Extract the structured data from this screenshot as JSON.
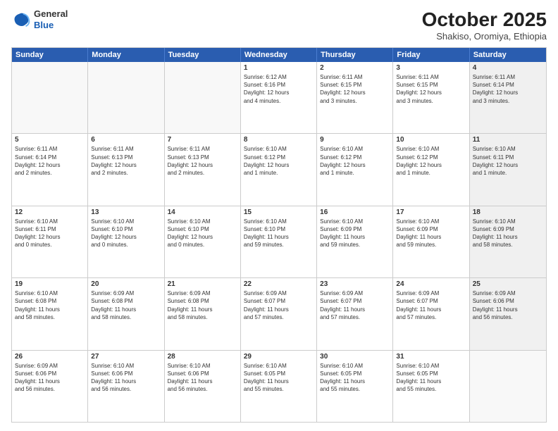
{
  "header": {
    "logo_line1": "General",
    "logo_line2": "Blue",
    "month": "October 2025",
    "location": "Shakiso, Oromiya, Ethiopia"
  },
  "weekdays": [
    "Sunday",
    "Monday",
    "Tuesday",
    "Wednesday",
    "Thursday",
    "Friday",
    "Saturday"
  ],
  "rows": [
    [
      {
        "day": "",
        "text": "",
        "empty": true
      },
      {
        "day": "",
        "text": "",
        "empty": true
      },
      {
        "day": "",
        "text": "",
        "empty": true
      },
      {
        "day": "1",
        "text": "Sunrise: 6:12 AM\nSunset: 6:16 PM\nDaylight: 12 hours\nand 4 minutes.",
        "empty": false
      },
      {
        "day": "2",
        "text": "Sunrise: 6:11 AM\nSunset: 6:15 PM\nDaylight: 12 hours\nand 3 minutes.",
        "empty": false
      },
      {
        "day": "3",
        "text": "Sunrise: 6:11 AM\nSunset: 6:15 PM\nDaylight: 12 hours\nand 3 minutes.",
        "empty": false
      },
      {
        "day": "4",
        "text": "Sunrise: 6:11 AM\nSunset: 6:14 PM\nDaylight: 12 hours\nand 3 minutes.",
        "empty": false,
        "shaded": true
      }
    ],
    [
      {
        "day": "5",
        "text": "Sunrise: 6:11 AM\nSunset: 6:14 PM\nDaylight: 12 hours\nand 2 minutes.",
        "empty": false
      },
      {
        "day": "6",
        "text": "Sunrise: 6:11 AM\nSunset: 6:13 PM\nDaylight: 12 hours\nand 2 minutes.",
        "empty": false
      },
      {
        "day": "7",
        "text": "Sunrise: 6:11 AM\nSunset: 6:13 PM\nDaylight: 12 hours\nand 2 minutes.",
        "empty": false
      },
      {
        "day": "8",
        "text": "Sunrise: 6:10 AM\nSunset: 6:12 PM\nDaylight: 12 hours\nand 1 minute.",
        "empty": false
      },
      {
        "day": "9",
        "text": "Sunrise: 6:10 AM\nSunset: 6:12 PM\nDaylight: 12 hours\nand 1 minute.",
        "empty": false
      },
      {
        "day": "10",
        "text": "Sunrise: 6:10 AM\nSunset: 6:12 PM\nDaylight: 12 hours\nand 1 minute.",
        "empty": false
      },
      {
        "day": "11",
        "text": "Sunrise: 6:10 AM\nSunset: 6:11 PM\nDaylight: 12 hours\nand 1 minute.",
        "empty": false,
        "shaded": true
      }
    ],
    [
      {
        "day": "12",
        "text": "Sunrise: 6:10 AM\nSunset: 6:11 PM\nDaylight: 12 hours\nand 0 minutes.",
        "empty": false
      },
      {
        "day": "13",
        "text": "Sunrise: 6:10 AM\nSunset: 6:10 PM\nDaylight: 12 hours\nand 0 minutes.",
        "empty": false
      },
      {
        "day": "14",
        "text": "Sunrise: 6:10 AM\nSunset: 6:10 PM\nDaylight: 12 hours\nand 0 minutes.",
        "empty": false
      },
      {
        "day": "15",
        "text": "Sunrise: 6:10 AM\nSunset: 6:10 PM\nDaylight: 11 hours\nand 59 minutes.",
        "empty": false
      },
      {
        "day": "16",
        "text": "Sunrise: 6:10 AM\nSunset: 6:09 PM\nDaylight: 11 hours\nand 59 minutes.",
        "empty": false
      },
      {
        "day": "17",
        "text": "Sunrise: 6:10 AM\nSunset: 6:09 PM\nDaylight: 11 hours\nand 59 minutes.",
        "empty": false
      },
      {
        "day": "18",
        "text": "Sunrise: 6:10 AM\nSunset: 6:09 PM\nDaylight: 11 hours\nand 58 minutes.",
        "empty": false,
        "shaded": true
      }
    ],
    [
      {
        "day": "19",
        "text": "Sunrise: 6:10 AM\nSunset: 6:08 PM\nDaylight: 11 hours\nand 58 minutes.",
        "empty": false
      },
      {
        "day": "20",
        "text": "Sunrise: 6:09 AM\nSunset: 6:08 PM\nDaylight: 11 hours\nand 58 minutes.",
        "empty": false
      },
      {
        "day": "21",
        "text": "Sunrise: 6:09 AM\nSunset: 6:08 PM\nDaylight: 11 hours\nand 58 minutes.",
        "empty": false
      },
      {
        "day": "22",
        "text": "Sunrise: 6:09 AM\nSunset: 6:07 PM\nDaylight: 11 hours\nand 57 minutes.",
        "empty": false
      },
      {
        "day": "23",
        "text": "Sunrise: 6:09 AM\nSunset: 6:07 PM\nDaylight: 11 hours\nand 57 minutes.",
        "empty": false
      },
      {
        "day": "24",
        "text": "Sunrise: 6:09 AM\nSunset: 6:07 PM\nDaylight: 11 hours\nand 57 minutes.",
        "empty": false
      },
      {
        "day": "25",
        "text": "Sunrise: 6:09 AM\nSunset: 6:06 PM\nDaylight: 11 hours\nand 56 minutes.",
        "empty": false,
        "shaded": true
      }
    ],
    [
      {
        "day": "26",
        "text": "Sunrise: 6:09 AM\nSunset: 6:06 PM\nDaylight: 11 hours\nand 56 minutes.",
        "empty": false
      },
      {
        "day": "27",
        "text": "Sunrise: 6:10 AM\nSunset: 6:06 PM\nDaylight: 11 hours\nand 56 minutes.",
        "empty": false
      },
      {
        "day": "28",
        "text": "Sunrise: 6:10 AM\nSunset: 6:06 PM\nDaylight: 11 hours\nand 56 minutes.",
        "empty": false
      },
      {
        "day": "29",
        "text": "Sunrise: 6:10 AM\nSunset: 6:05 PM\nDaylight: 11 hours\nand 55 minutes.",
        "empty": false
      },
      {
        "day": "30",
        "text": "Sunrise: 6:10 AM\nSunset: 6:05 PM\nDaylight: 11 hours\nand 55 minutes.",
        "empty": false
      },
      {
        "day": "31",
        "text": "Sunrise: 6:10 AM\nSunset: 6:05 PM\nDaylight: 11 hours\nand 55 minutes.",
        "empty": false
      },
      {
        "day": "",
        "text": "",
        "empty": true,
        "shaded": true
      }
    ]
  ]
}
